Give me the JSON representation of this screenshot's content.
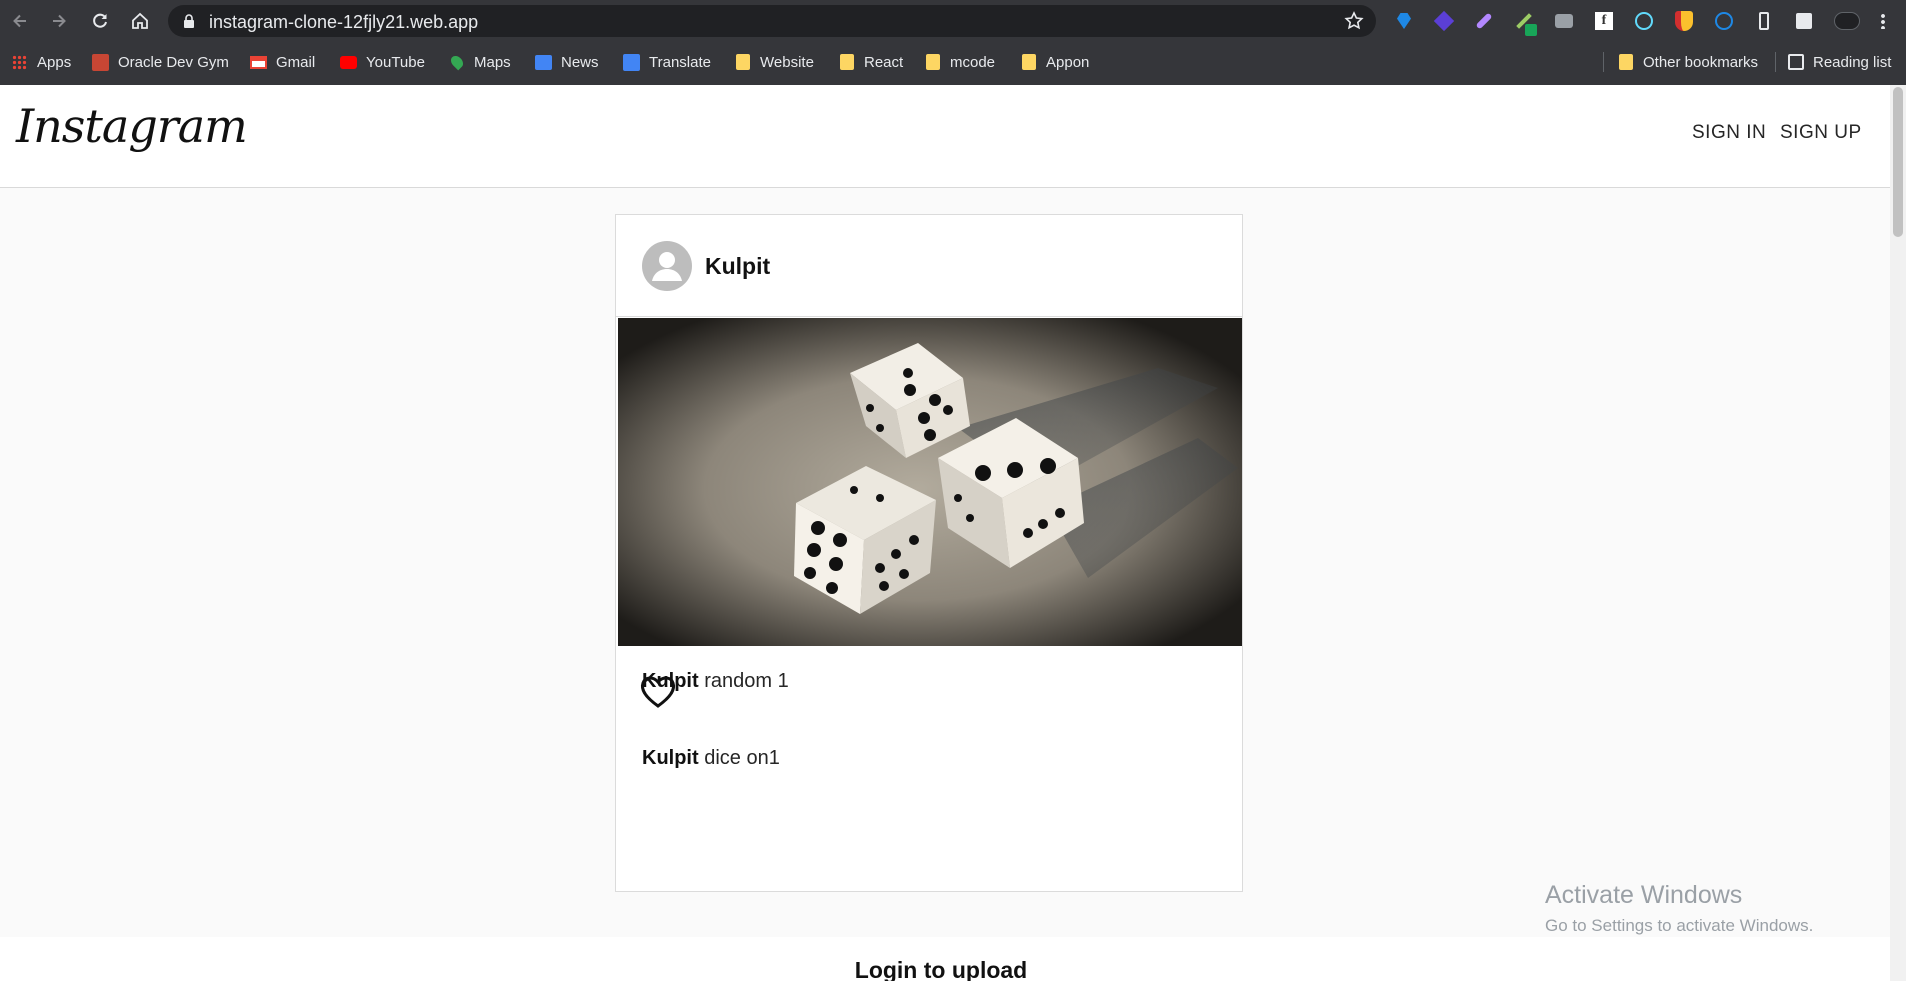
{
  "browser": {
    "url": "instagram-clone-12fjly21.web.app",
    "bookmarks": [
      {
        "label": "Apps",
        "icon": "apps-grid-icon"
      },
      {
        "label": "Oracle Dev Gym",
        "icon": "oracle-dev-gym-icon"
      },
      {
        "label": "Gmail",
        "icon": "gmail-icon"
      },
      {
        "label": "YouTube",
        "icon": "youtube-icon"
      },
      {
        "label": "Maps",
        "icon": "maps-icon"
      },
      {
        "label": "News",
        "icon": "news-icon"
      },
      {
        "label": "Translate",
        "icon": "translate-icon"
      },
      {
        "label": "Website",
        "icon": "folder-icon"
      },
      {
        "label": "React",
        "icon": "folder-icon"
      },
      {
        "label": "mcode",
        "icon": "folder-icon"
      },
      {
        "label": "Appon",
        "icon": "folder-icon"
      }
    ],
    "other_bookmarks": "Other bookmarks",
    "reading_list": "Reading list"
  },
  "app": {
    "logo": "Instagram",
    "sign_in": "SIGN IN",
    "sign_up": "SIGN UP"
  },
  "post": {
    "username": "Kulpit",
    "image_alt": "three dice",
    "comments": [
      {
        "user": "Kulpit",
        "text": "random 1"
      },
      {
        "user": "Kulpit",
        "text": "dice on1"
      }
    ]
  },
  "footer": {
    "upload_text": "Login to upload"
  },
  "watermark": {
    "title": "Activate Windows",
    "subtitle": "Go to Settings to activate Windows."
  },
  "colors": {
    "chrome": "#35363a",
    "omnibox": "#202124",
    "page_bg": "#fafafa",
    "border": "#dbdbdb"
  }
}
